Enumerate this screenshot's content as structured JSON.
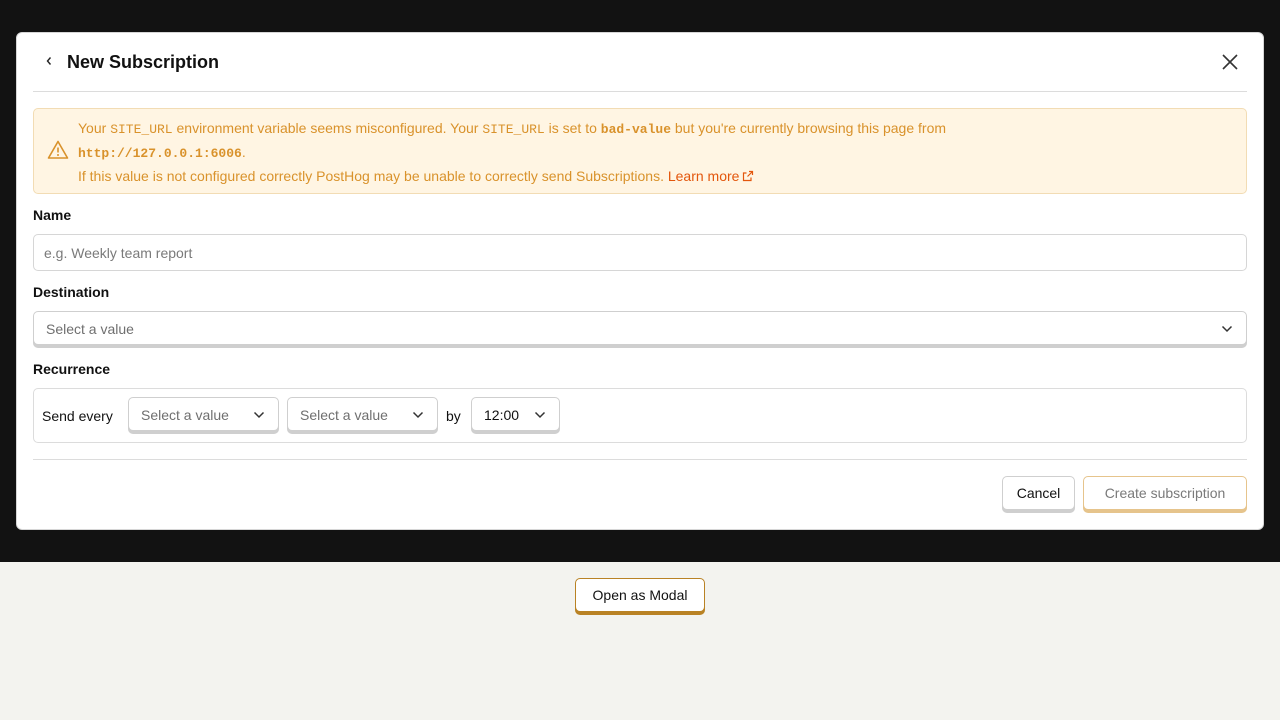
{
  "modal": {
    "title": "New Subscription",
    "warning": {
      "part1": "Your ",
      "var1": "SITE_URL",
      "part2": " environment variable seems misconfigured. Your ",
      "var2": "SITE_URL",
      "part3": " is set to ",
      "value": "bad-value",
      "part4": " but you're currently browsing this page from",
      "origin": "http://127.0.0.1:6006",
      "part5": ".",
      "line3": "If this value is not configured correctly PostHog may be unable to correctly send Subscriptions.",
      "learn_more": "Learn more"
    },
    "form": {
      "name_label": "Name",
      "name_placeholder": "e.g. Weekly team report",
      "destination_label": "Destination",
      "destination_value": "Select a value",
      "recurrence_label": "Recurrence",
      "send_every": "Send every",
      "frequency_value": "Select a value",
      "interval_value": "Select a value",
      "by": "by",
      "time_value": "12:00"
    },
    "footer": {
      "cancel": "Cancel",
      "create": "Create subscription"
    }
  },
  "page": {
    "open_modal": "Open as Modal"
  },
  "colors": {
    "warning_text": "#d9922b",
    "warning_bg": "#fff5e3",
    "link": "#e3560c",
    "backdrop": "#121212",
    "page_bg": "#f3f3ef"
  }
}
